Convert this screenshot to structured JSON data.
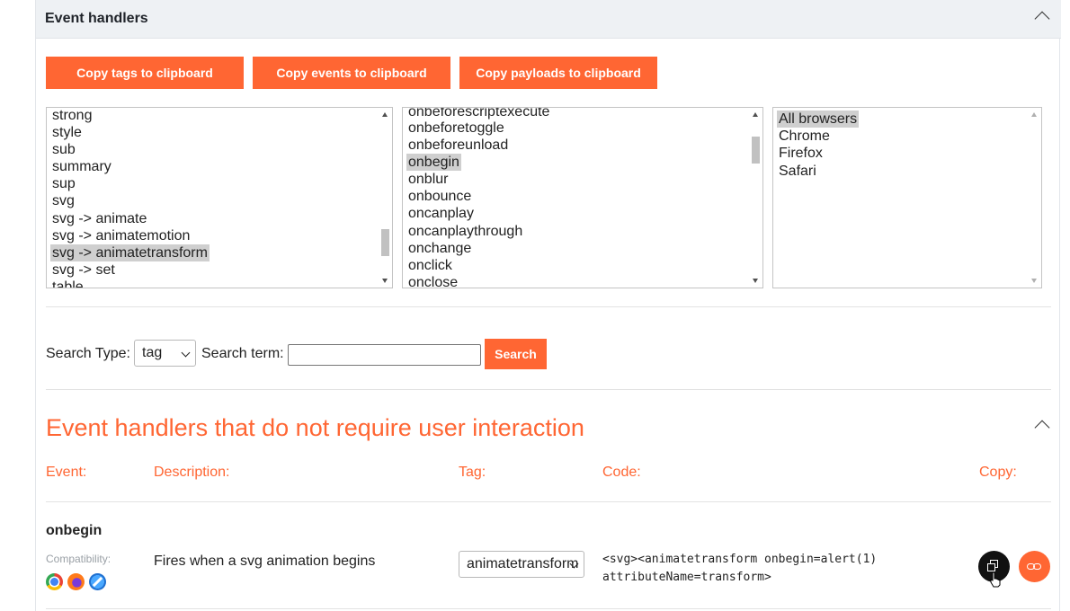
{
  "panel": {
    "title": "Event handlers"
  },
  "buttons": {
    "copy_tags": "Copy tags to clipboard",
    "copy_events": "Copy events to clipboard",
    "copy_payloads": "Copy payloads to clipboard"
  },
  "tags_list": {
    "items": [
      "strong",
      "style",
      "sub",
      "summary",
      "sup",
      "svg",
      "svg -> animate",
      "svg -> animatemotion",
      "svg -> animatetransform",
      "svg -> set",
      "table"
    ],
    "selected": "svg -> animatetransform"
  },
  "events_list": {
    "items": [
      "onbeforescriptexecute",
      "onbeforetoggle",
      "onbeforeunload",
      "onbegin",
      "onblur",
      "onbounce",
      "oncanplay",
      "oncanplaythrough",
      "onchange",
      "onclick",
      "onclose"
    ],
    "selected": "onbegin"
  },
  "browsers_list": {
    "items": [
      "All browsers",
      "Chrome",
      "Firefox",
      "Safari"
    ],
    "selected": "All browsers"
  },
  "search": {
    "type_label": "Search Type:",
    "type_value": "tag",
    "term_label": "Search term:",
    "term_value": "",
    "button": "Search"
  },
  "section": {
    "title": "Event handlers that do not require user interaction",
    "columns": {
      "event": "Event:",
      "description": "Description:",
      "tag": "Tag:",
      "code": "Code:",
      "copy": "Copy:"
    }
  },
  "rows": [
    {
      "event": "onbegin",
      "compat_label": "Compatibility:",
      "browsers": [
        "chrome-icon",
        "firefox-icon",
        "safari-icon"
      ],
      "description": "Fires when a svg animation begins",
      "tag": "animatetransform",
      "code_line1": "<svg><animatetransform onbegin=alert(1)",
      "code_line2": "attributeName=transform>"
    }
  ],
  "colors": {
    "accent": "#ff6633",
    "header_bg": "#eef1f4",
    "selection": "#cfcfcf"
  }
}
